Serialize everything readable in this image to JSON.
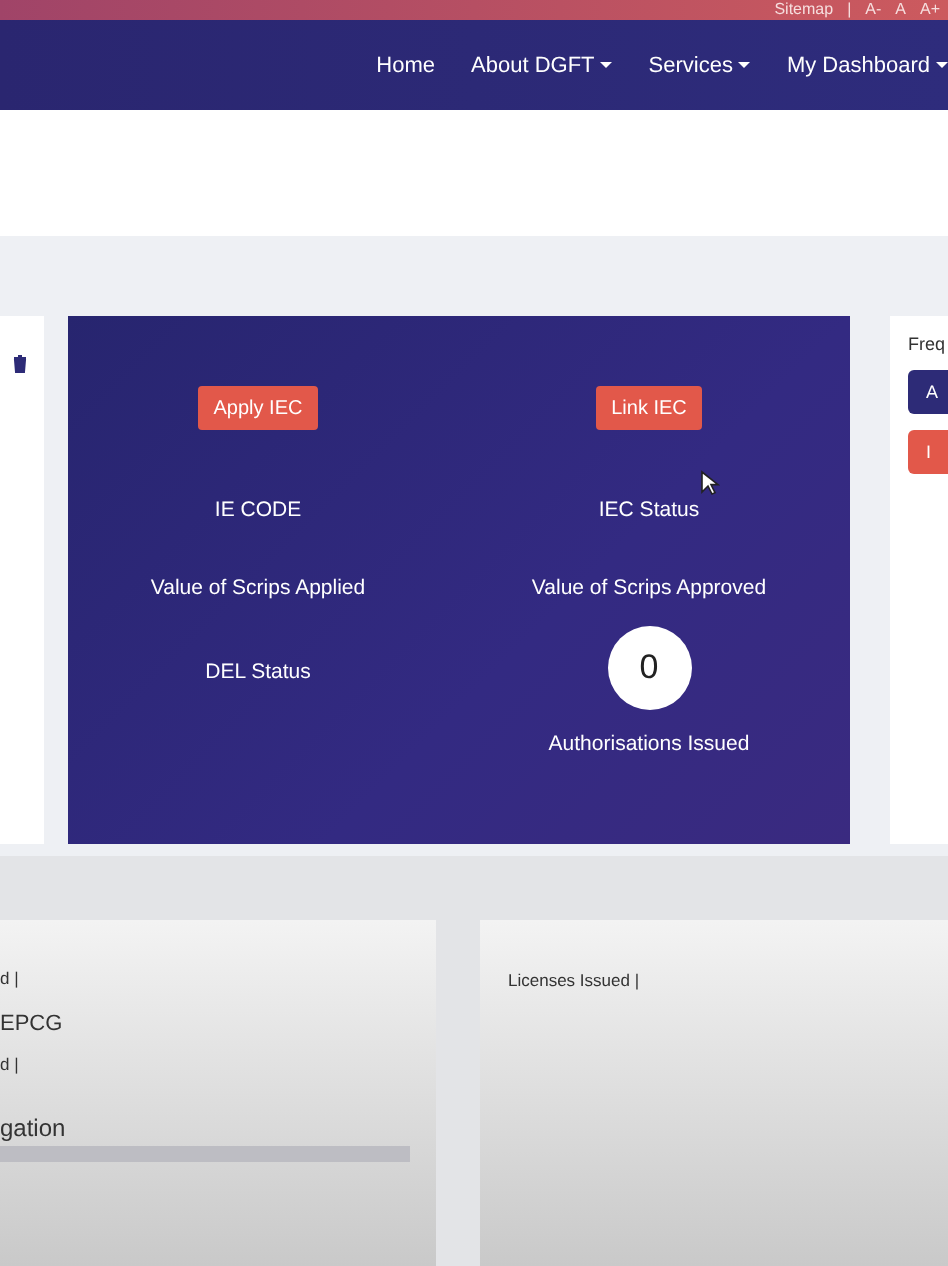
{
  "top_bar": {
    "sitemap": "Sitemap",
    "separator": "|",
    "font_sizes": [
      "A-",
      "A",
      "A+"
    ]
  },
  "nav": {
    "items": [
      {
        "label": "Home",
        "dropdown": false
      },
      {
        "label": "About DGFT",
        "dropdown": true
      },
      {
        "label": "Services",
        "dropdown": true
      },
      {
        "label": "My Dashboard",
        "dropdown": true
      }
    ]
  },
  "iec_panel": {
    "columns": [
      {
        "button": "Apply IEC",
        "fields": [
          "IE CODE",
          "Value of Scrips Applied",
          "DEL Status"
        ]
      },
      {
        "button": "Link IEC",
        "fields": [
          "IEC Status",
          "Value of Scrips Approved"
        ],
        "count": "0",
        "count_label": "Authorisations Issued"
      }
    ]
  },
  "freq_card": {
    "title": "Freq",
    "buttons": [
      {
        "label": "A",
        "kind": "primary"
      },
      {
        "label": "I",
        "kind": "danger"
      }
    ]
  },
  "bottom_left": {
    "lines": [
      {
        "kind": "text",
        "text": "d |"
      },
      {
        "kind": "heading",
        "text": "EPCG"
      },
      {
        "kind": "text",
        "text": "d |"
      },
      {
        "kind": "title",
        "text": "gation"
      },
      {
        "kind": "bar"
      }
    ]
  },
  "bottom_right": {
    "lines": [
      {
        "kind": "text",
        "text": "Licenses Issued |"
      }
    ]
  }
}
